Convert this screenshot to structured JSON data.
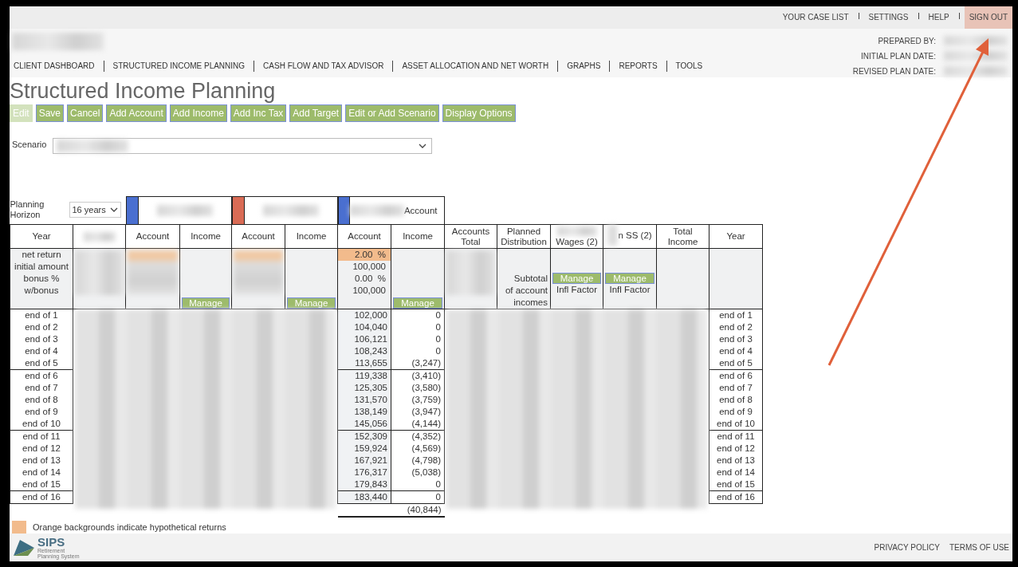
{
  "top_links": [
    {
      "label": "YOUR CASE LIST",
      "highlighted": false
    },
    {
      "label": "SETTINGS",
      "highlighted": false
    },
    {
      "label": "HELP",
      "highlighted": false
    },
    {
      "label": "SIGN OUT",
      "highlighted": true
    }
  ],
  "plan_info_labels": [
    "PREPARED BY:",
    "INITIAL PLAN DATE:",
    "REVISED PLAN DATE:"
  ],
  "nav": [
    "CLIENT DASHBOARD",
    "STRUCTURED INCOME PLANNING",
    "CASH FLOW AND TAX ADVISOR",
    "ASSET ALLOCATION AND NET WORTH",
    "GRAPHS",
    "REPORTS",
    "TOOLS"
  ],
  "page_title": "Structured Income Planning",
  "toolbar": [
    {
      "label": "Edit",
      "disabled": true
    },
    {
      "label": "Save",
      "disabled": false
    },
    {
      "label": "Cancel",
      "disabled": false
    },
    {
      "label": "Add Account",
      "disabled": false
    },
    {
      "label": "Add Income",
      "disabled": false
    },
    {
      "label": "Add Inc Tax",
      "disabled": false
    },
    {
      "label": "Add Target",
      "disabled": false
    },
    {
      "label": "Edit or Add Scenario",
      "disabled": false
    },
    {
      "label": "Display Options",
      "disabled": false
    }
  ],
  "scenario": {
    "label": "Scenario"
  },
  "planning_horizon": {
    "label": "Planning Horizon",
    "value": "16 years"
  },
  "account_groups": [
    {
      "color": "#4a6fd0"
    },
    {
      "color": "#d96b55"
    },
    {
      "color": "#4a6fd0",
      "title": "Account"
    }
  ],
  "columns": [
    {
      "kind": "text",
      "label": "Year"
    },
    {
      "kind": "blurred"
    },
    {
      "kind": "text",
      "label": "Account"
    },
    {
      "kind": "text",
      "label": "Income"
    },
    {
      "kind": "text",
      "label": "Account"
    },
    {
      "kind": "text",
      "label": "Income"
    },
    {
      "kind": "text",
      "label": "Account"
    },
    {
      "kind": "text",
      "label": "Income"
    },
    {
      "kind": "text",
      "label": "Accounts Total"
    },
    {
      "kind": "text",
      "label": "Planned Distribution"
    },
    {
      "kind": "blur_above",
      "label": "Wages (2)"
    },
    {
      "kind": "blur_before",
      "label": "n SS (2)"
    },
    {
      "kind": "text",
      "label": "Total Income"
    },
    {
      "kind": "text",
      "label": "Year"
    }
  ],
  "param_labels": [
    "net return",
    "initial amount",
    "bonus %",
    "w/bonus"
  ],
  "account_params": [
    {
      "value": "2.00  %",
      "hypothetical": true
    },
    {
      "value": "100,000",
      "hypothetical": false
    },
    {
      "value": "0.00  %",
      "hypothetical": false
    },
    {
      "value": "100,000",
      "hypothetical": false
    }
  ],
  "manage_buttons": [
    "Manage",
    "Manage",
    "Manage"
  ],
  "distribution_note_lines": [
    "Subtotal",
    "of account",
    "incomes"
  ],
  "indexed_incomes": [
    {
      "button": "Manage",
      "note": "Infl Factor"
    },
    {
      "button": "Manage",
      "note": "Infl Factor"
    }
  ],
  "rows": [
    {
      "year": "end of 1",
      "account": "102,000",
      "income": "0",
      "year_right": "end of 1"
    },
    {
      "year": "end of 2",
      "account": "104,040",
      "income": "0",
      "year_right": "end of 2"
    },
    {
      "year": "end of 3",
      "account": "106,121",
      "income": "0",
      "year_right": "end of 3"
    },
    {
      "year": "end of 4",
      "account": "108,243",
      "income": "0",
      "year_right": "end of 4"
    },
    {
      "year": "end of 5",
      "account": "113,655",
      "income": "(3,247)",
      "year_right": "end of 5"
    },
    {
      "year": "end of 6",
      "account": "119,338",
      "income": "(3,410)",
      "year_right": "end of 6"
    },
    {
      "year": "end of 7",
      "account": "125,305",
      "income": "(3,580)",
      "year_right": "end of 7"
    },
    {
      "year": "end of 8",
      "account": "131,570",
      "income": "(3,759)",
      "year_right": "end of 8"
    },
    {
      "year": "end of 9",
      "account": "138,149",
      "income": "(3,947)",
      "year_right": "end of 9"
    },
    {
      "year": "end of 10",
      "account": "145,056",
      "income": "(4,144)",
      "year_right": "end of 10"
    },
    {
      "year": "end of 11",
      "account": "152,309",
      "income": "(4,352)",
      "year_right": "end of 11"
    },
    {
      "year": "end of 12",
      "account": "159,924",
      "income": "(4,569)",
      "year_right": "end of 12"
    },
    {
      "year": "end of 13",
      "account": "167,921",
      "income": "(4,798)",
      "year_right": "end of 13"
    },
    {
      "year": "end of 14",
      "account": "176,317",
      "income": "(5,038)",
      "year_right": "end of 14"
    },
    {
      "year": "end of 15",
      "account": "179,843",
      "income": "0",
      "year_right": "end of 15"
    },
    {
      "year": "end of 16",
      "account": "183,440",
      "income": "0",
      "year_right": "end of 16"
    }
  ],
  "income_total": "(40,844)",
  "legend": {
    "color": "#f2bb8c",
    "text": "Orange backgrounds indicate hypothetical returns"
  },
  "footer": {
    "logo": "SIPS",
    "tagline_lines": [
      "Retirement",
      "Planning System"
    ],
    "links": [
      "PRIVACY POLICY",
      "TERMS OF USE"
    ]
  }
}
